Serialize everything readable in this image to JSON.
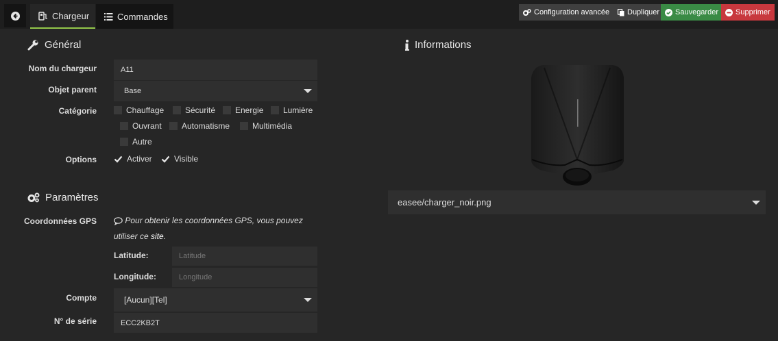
{
  "tabs": [
    {
      "label": "Chargeur",
      "icon": "charger-icon"
    },
    {
      "label": "Commandes",
      "icon": "list-icon"
    }
  ],
  "toolbar": {
    "config_label": "Configuration avancée",
    "duplicate_label": "Dupliquer",
    "save_label": "Sauvegarder",
    "delete_label": "Supprimer"
  },
  "general": {
    "title": "Général",
    "name_label": "Nom du chargeur",
    "name_value": "A11",
    "parent_label": "Objet parent",
    "parent_value": "Base",
    "category_label": "Catégorie",
    "categories": [
      {
        "label": "Chauffage",
        "checked": false
      },
      {
        "label": "Sécurité",
        "checked": false
      },
      {
        "label": "Energie",
        "checked": false
      },
      {
        "label": "Lumière",
        "checked": false
      },
      {
        "label": "Ouvrant",
        "checked": false
      },
      {
        "label": "Automatisme",
        "checked": false
      },
      {
        "label": "Multimédia",
        "checked": false
      },
      {
        "label": "Autre",
        "checked": false
      }
    ],
    "options_label": "Options",
    "options": [
      {
        "label": "Activer",
        "checked": true
      },
      {
        "label": "Visible",
        "checked": true
      }
    ]
  },
  "params": {
    "title": "Paramètres",
    "gps_label": "Coordonnées GPS",
    "gps_note_before": "Pour obtenir les coordonnées GPS, vous pouvez",
    "gps_note_line2_prefix": "utiliser ce ",
    "gps_note_link": "site",
    "gps_note_suffix": ".",
    "latitude_label": "Latitude:",
    "latitude_placeholder": "Latitude",
    "longitude_label": "Longitude:",
    "longitude_placeholder": "Longitude",
    "account_label": "Compte",
    "account_value": "[Aucun][Tel]",
    "serial_label": "N° de série",
    "serial_value": "ECC2KB2T"
  },
  "info": {
    "title": "Informations",
    "image_select_value": "easee/charger_noir.png"
  }
}
